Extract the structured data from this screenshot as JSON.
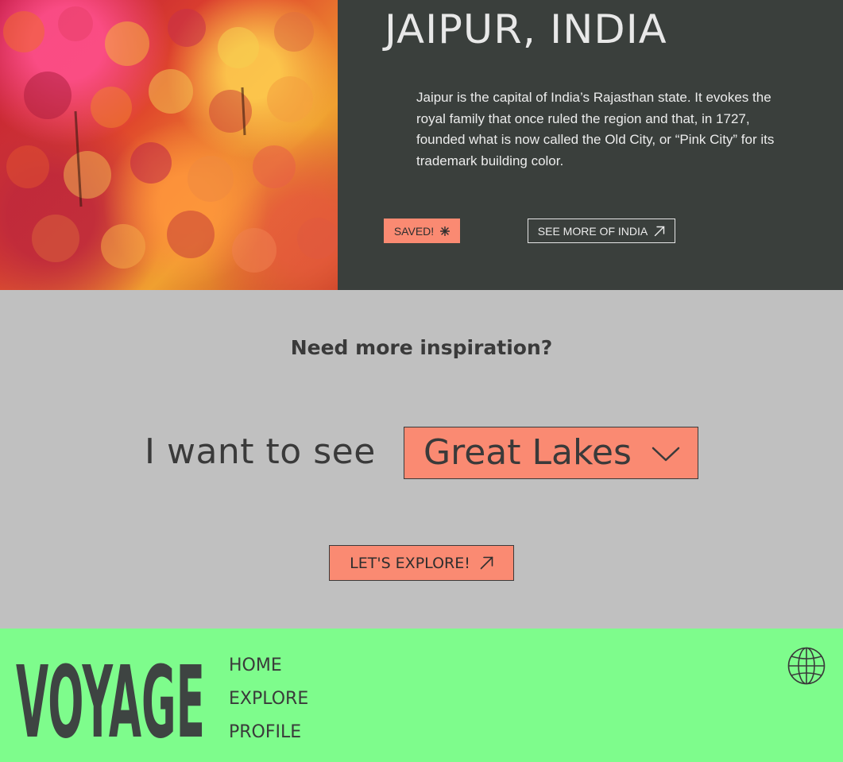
{
  "hero": {
    "title": "JAIPUR, INDIA",
    "description": "Jaipur is the capital of India’s Rajasthan state. It evokes the royal family that once ruled the region and that, in 1727, founded what is now called the Old City, or “Pink City” for its trademark building color.",
    "saved_label": "SAVED!",
    "saved_icon": "asterisk-icon",
    "see_more_label": "SEE MORE OF INDIA",
    "see_more_icon": "arrow-up-right-icon"
  },
  "inspire": {
    "heading": "Need more inspiration?",
    "want_label": "I want to see",
    "selected_destination": "Great Lakes",
    "explore_label": "LET'S EXPLORE!"
  },
  "footer": {
    "logo": "VOYAGE",
    "nav": [
      "HOME",
      "EXPLORE",
      "PROFILE"
    ],
    "globe_icon": "globe-icon"
  },
  "colors": {
    "hero_bg": "#3a3f3c",
    "accent": "#fa8a72",
    "inspire_bg": "#c0c0c0",
    "footer_bg": "#7efc8c",
    "text_dark": "#3a3a3a"
  }
}
